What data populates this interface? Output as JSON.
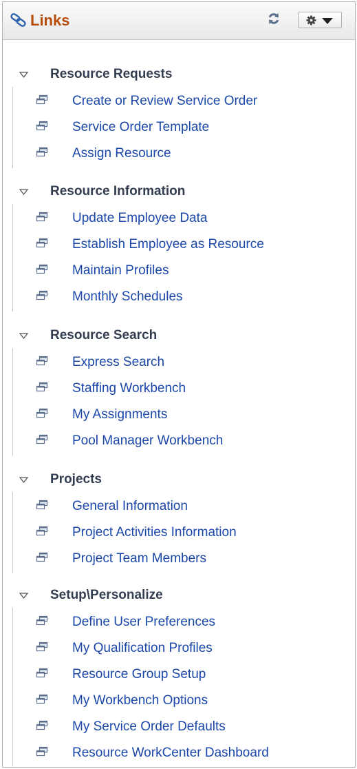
{
  "header": {
    "title": "Links",
    "icons": {
      "links": "links-icon",
      "refresh": "refresh-icon",
      "options": "gear-icon",
      "dropdown": "chevron-down-icon"
    }
  },
  "colors": {
    "title": "#b84c0a",
    "section_title": "#333d50",
    "link": "#1a47a8",
    "border": "#b3b3b3"
  },
  "sections": [
    {
      "title": "Resource Requests",
      "links": [
        "Create or Review Service Order",
        "Service Order Template",
        "Assign Resource"
      ]
    },
    {
      "title": "Resource Information",
      "links": [
        "Update Employee Data",
        "Establish Employee as Resource",
        "Maintain Profiles",
        "Monthly Schedules"
      ]
    },
    {
      "title": "Resource Search",
      "links": [
        "Express Search",
        "Staffing Workbench",
        "My Assignments",
        "Pool Manager Workbench"
      ]
    },
    {
      "title": "Projects",
      "links": [
        "General Information",
        "Project Activities Information",
        "Project Team Members"
      ]
    },
    {
      "title": "Setup\\Personalize",
      "links": [
        "Define User Preferences",
        "My Qualification Profiles",
        "Resource Group Setup",
        "My Workbench Options",
        "My Service Order Defaults",
        "Resource WorkCenter Dashboard"
      ]
    }
  ]
}
